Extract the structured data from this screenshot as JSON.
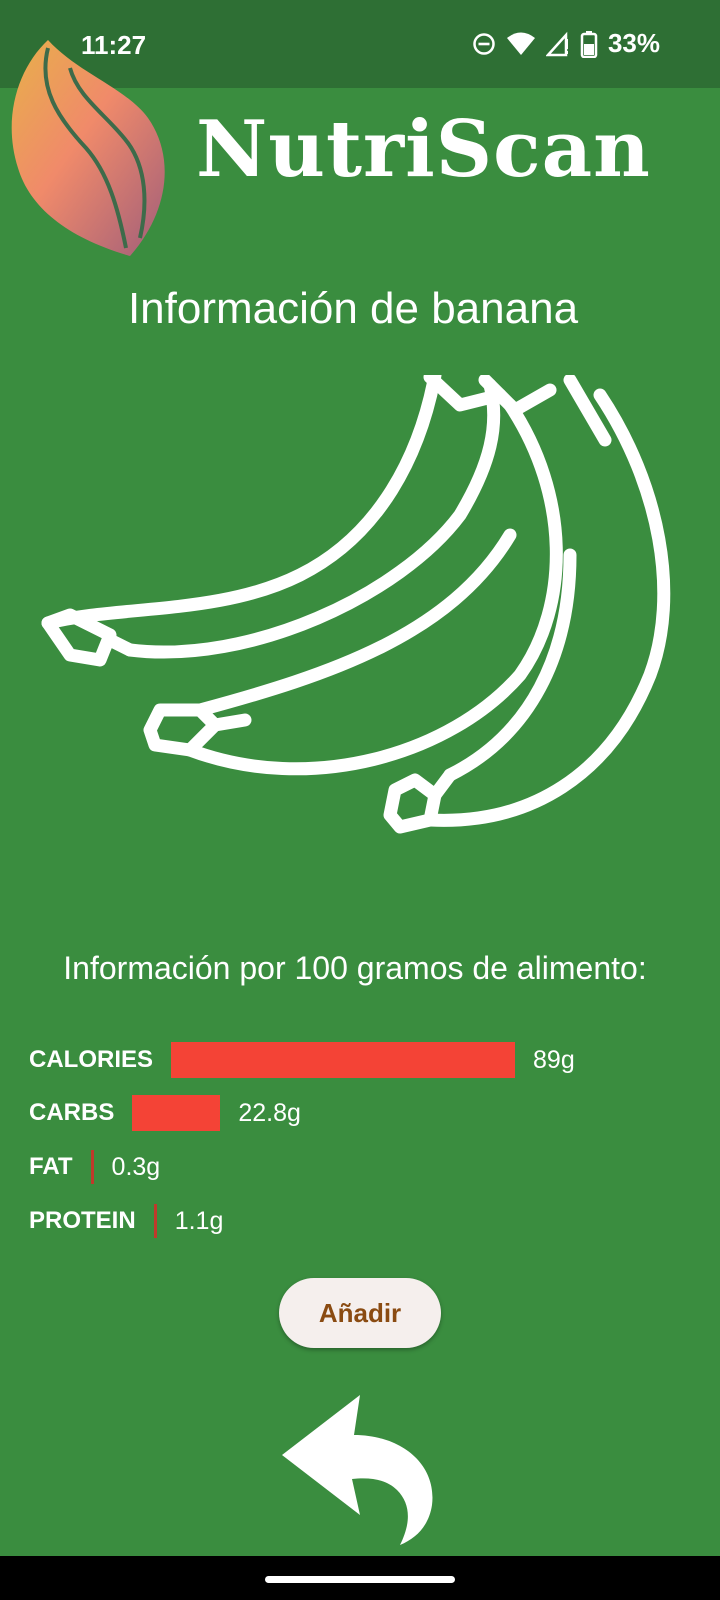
{
  "status_bar": {
    "time": "11:27",
    "battery": "33%",
    "icons": [
      "do-not-disturb-icon",
      "wifi-icon",
      "signal-icon",
      "battery-icon"
    ]
  },
  "app": {
    "title": "NutriScan",
    "logo_icon": "flame-logo-icon"
  },
  "food": {
    "title": "Información de banana",
    "image_icon": "banana-icon"
  },
  "nutrition": {
    "per_100_text": "Información por 100 gramos de alimento:",
    "items": [
      {
        "label": "CALORIES",
        "value": "89g",
        "amount": 89
      },
      {
        "label": "CARBS",
        "value": "22.8g",
        "amount": 22.8
      },
      {
        "label": "FAT",
        "value": "0.3g",
        "amount": 0.3
      },
      {
        "label": "PROTEIN",
        "value": "1.1g",
        "amount": 1.1
      }
    ],
    "bar_color": "#f44336"
  },
  "actions": {
    "add_label": "Añadir",
    "back_icon": "back-arrow-icon"
  },
  "colors": {
    "background": "#3a8d3f",
    "status_bar": "#2e6f34",
    "button_bg": "#f5efed",
    "button_text": "#8a4b12"
  }
}
